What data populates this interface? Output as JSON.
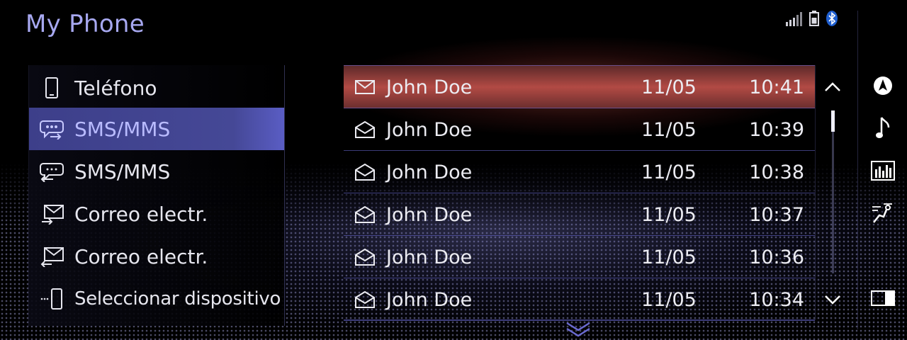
{
  "header": {
    "title": "My Phone"
  },
  "status": {
    "signal_bars": 5,
    "icons": [
      "signal-icon",
      "battery-icon",
      "bluetooth-icon"
    ]
  },
  "menu": {
    "items": [
      {
        "label": "Teléfono",
        "icon": "phone-icon",
        "selected": false
      },
      {
        "label": "SMS/MMS",
        "icon": "sms-incoming-icon",
        "selected": true
      },
      {
        "label": "SMS/MMS",
        "icon": "sms-outgoing-icon",
        "selected": false
      },
      {
        "label": "Correo electr.",
        "icon": "mail-incoming-icon",
        "selected": false
      },
      {
        "label": "Correo electr.",
        "icon": "mail-outgoing-icon",
        "selected": false
      },
      {
        "label": "Seleccionar dispositivo",
        "icon": "select-device-icon",
        "selected": false
      }
    ]
  },
  "messages": {
    "rows": [
      {
        "name": "John Doe",
        "date": "11/05",
        "time": "10:41",
        "status": "unread",
        "highlighted": true
      },
      {
        "name": "John Doe",
        "date": "11/05",
        "time": "10:39",
        "status": "read",
        "highlighted": false
      },
      {
        "name": "John Doe",
        "date": "11/05",
        "time": "10:38",
        "status": "read",
        "highlighted": false
      },
      {
        "name": "John Doe",
        "date": "11/05",
        "time": "10:37",
        "status": "read",
        "highlighted": false
      },
      {
        "name": "John Doe",
        "date": "11/05",
        "time": "10:36",
        "status": "read",
        "highlighted": false
      },
      {
        "name": "John Doe",
        "date": "11/05",
        "time": "10:34",
        "status": "read",
        "highlighted": false
      }
    ]
  },
  "scrollbar": {
    "position": 0.0,
    "visible_fraction": 0.13
  },
  "rail": {
    "buttons": [
      "navigation-icon",
      "music-note-icon",
      "equalizer-icon",
      "climate-icon",
      "split-screen-icon"
    ]
  },
  "colors": {
    "accent": "#a7a8f0",
    "selected_bg": "#454896",
    "highlight": "#b24a44",
    "divider": "#6e6edc"
  }
}
